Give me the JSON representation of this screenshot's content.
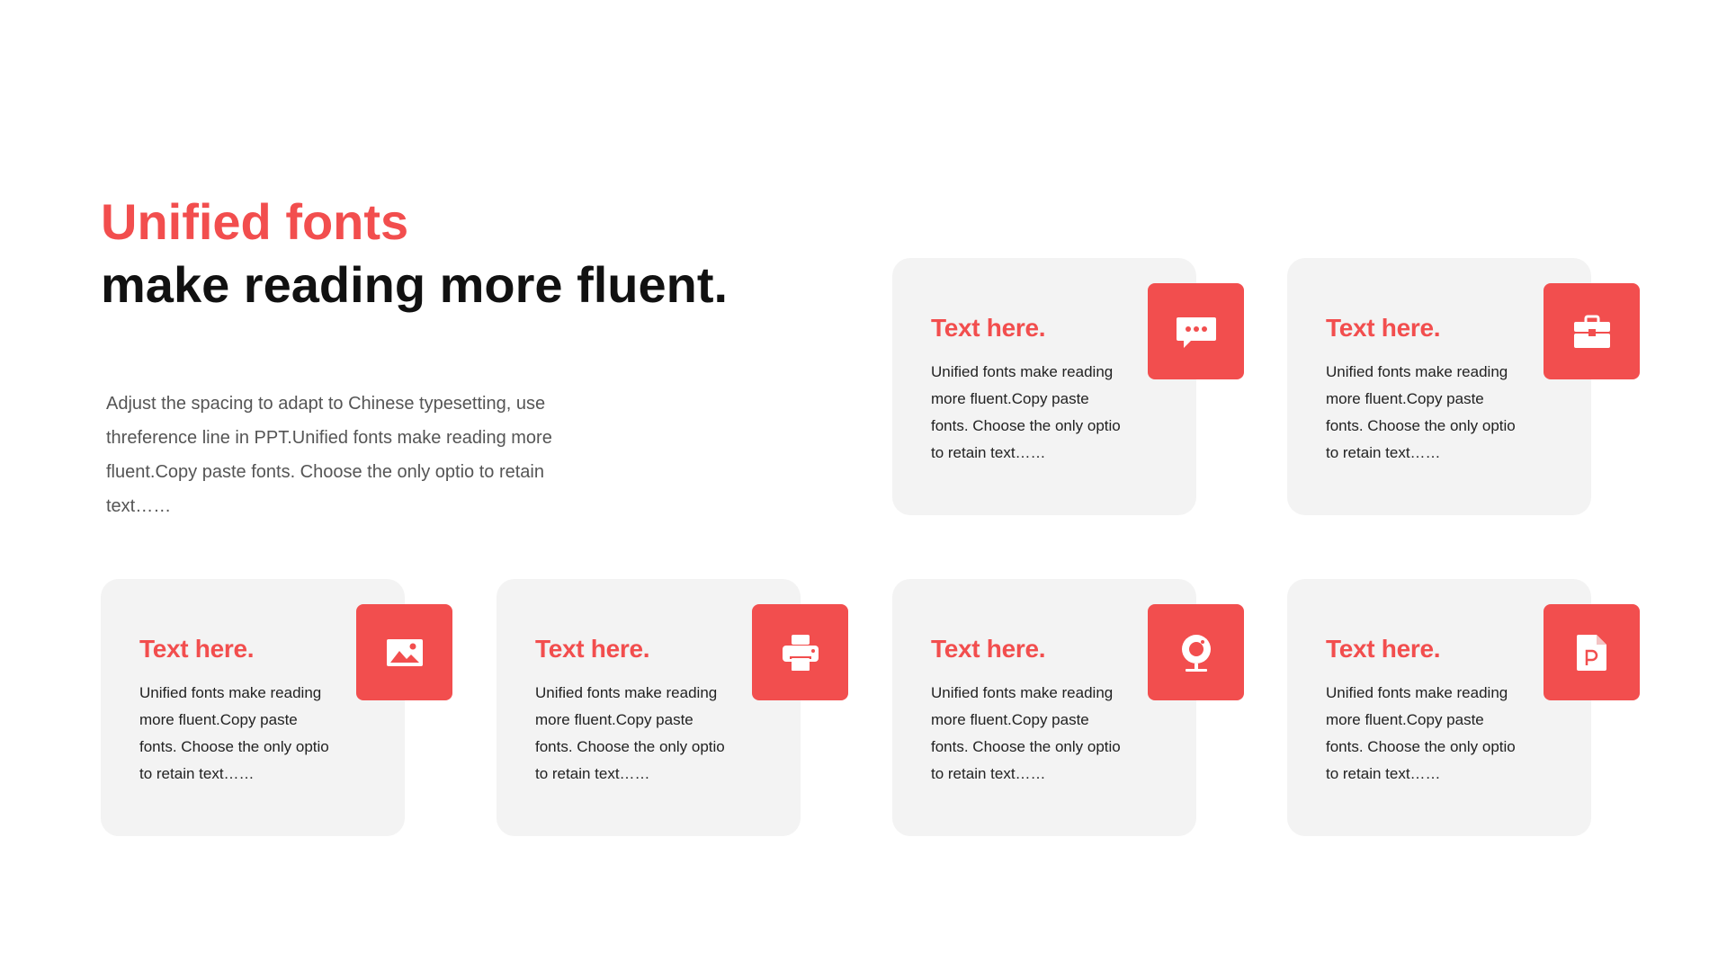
{
  "headline": {
    "line1": "Unified fonts",
    "line2": "make reading more fluent."
  },
  "intro": "Adjust the spacing to adapt to Chinese typesetting, use threference line in PPT.Unified fonts make reading more fluent.Copy paste fonts. Choose the only optio to retain text……",
  "colors": {
    "accent": "#f24e4e",
    "card_bg": "#f3f3f3",
    "heading": "#111111",
    "body_text": "#555555"
  },
  "cards": [
    {
      "title": "Text here.",
      "text": "Unified fonts make reading more fluent.Copy paste fonts. Choose the only optio to retain text……",
      "icon": "chat-bubble-icon"
    },
    {
      "title": "Text here.",
      "text": "Unified fonts make reading more fluent.Copy paste fonts. Choose the only optio to retain text……",
      "icon": "briefcase-icon"
    },
    {
      "title": "Text here.",
      "text": "Unified fonts make reading more fluent.Copy paste fonts. Choose the only optio to retain text……",
      "icon": "image-icon"
    },
    {
      "title": "Text here.",
      "text": "Unified fonts make reading more fluent.Copy paste fonts. Choose the only optio to retain text……",
      "icon": "printer-icon"
    },
    {
      "title": "Text here.",
      "text": "Unified fonts make reading more fluent.Copy paste fonts. Choose the only optio to retain text……",
      "icon": "webcam-icon"
    },
    {
      "title": "Text here.",
      "text": "Unified fonts make reading more fluent.Copy paste fonts. Choose the only optio to retain text……",
      "icon": "powerpoint-file-icon"
    }
  ]
}
